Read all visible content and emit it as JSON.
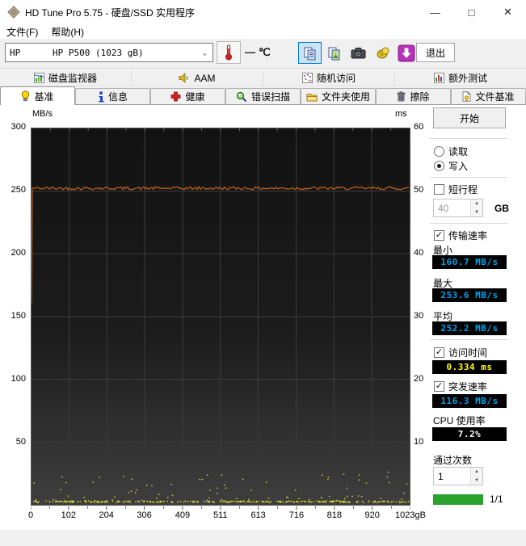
{
  "window": {
    "title": "HD Tune Pro 5.75 - 硬盘/SSD 实用程序",
    "controls": {
      "minimize": "—",
      "maximize": "□",
      "close": "✕"
    }
  },
  "menu": {
    "file": "文件(F)",
    "help": "帮助(H)"
  },
  "toolbar": {
    "drive_select": "HP      HP P500 (1023 gB)",
    "temperature": {
      "value": "—",
      "unit": "℃"
    },
    "exit_label": "退出"
  },
  "tabs_top": [
    {
      "label": "磁盘监视器"
    },
    {
      "label": "AAM"
    },
    {
      "label": "随机访问"
    },
    {
      "label": "额外测试"
    }
  ],
  "tabs_main": [
    {
      "label": "基准",
      "active": true
    },
    {
      "label": "信息",
      "active": false
    },
    {
      "label": "健康",
      "active": false
    },
    {
      "label": "错误扫描",
      "active": false
    },
    {
      "label": "文件夹使用",
      "active": false
    },
    {
      "label": "擦除",
      "active": false
    },
    {
      "label": "文件基准",
      "active": false
    }
  ],
  "panel": {
    "start_label": "开始",
    "read_label": "读取",
    "write_label": "写入",
    "read_selected": false,
    "write_selected": true,
    "short_stroke_label": "短行程",
    "short_stroke_checked": false,
    "short_stroke_value": "40",
    "short_stroke_unit": "GB",
    "transfer_rate_label": "传输速率",
    "transfer_rate_checked": true,
    "min_label": "最小",
    "min_value": "160.7 MB/s",
    "max_label": "最大",
    "max_value": "253.6 MB/s",
    "avg_label": "平均",
    "avg_value": "252.2 MB/s",
    "access_time_label": "访问时间",
    "access_time_checked": true,
    "access_time_value": "0.334 ms",
    "burst_rate_label": "突发速率",
    "burst_rate_checked": true,
    "burst_rate_value": "116.3 MB/s",
    "cpu_label": "CPU 使用率",
    "cpu_value": "7.2%",
    "pass_count_label": "通过次数",
    "pass_count_value": "1",
    "progress_label": "1/1"
  },
  "chart_data": {
    "type": "line+scatter",
    "x_axis": {
      "min": 0,
      "max": 1023,
      "ticks": [
        0,
        102,
        204,
        306,
        409,
        511,
        613,
        716,
        818,
        920,
        1023
      ],
      "last_suffix": "gB"
    },
    "y_left": {
      "label": "MB/s",
      "min": 0,
      "max": 300,
      "ticks": [
        50,
        100,
        150,
        200,
        250,
        300
      ]
    },
    "y_right": {
      "label": "ms",
      "min": 0,
      "max": 60,
      "ticks": [
        10,
        20,
        30,
        40,
        50,
        60
      ]
    },
    "transfer_rate_line": {
      "color": "#c2641c",
      "avg": 252.2,
      "min": 160.7,
      "max": 253.6,
      "start_value": 160.7
    },
    "access_time_scatter": {
      "color": "#dcdc3a",
      "typical_ms": 0.334,
      "spread_max_ms": 5.2
    },
    "grid": true,
    "colors": {
      "plot_bg_top": "#121212",
      "plot_bg_bottom": "#3e3e3e",
      "grid": "#3c3c3c"
    }
  }
}
